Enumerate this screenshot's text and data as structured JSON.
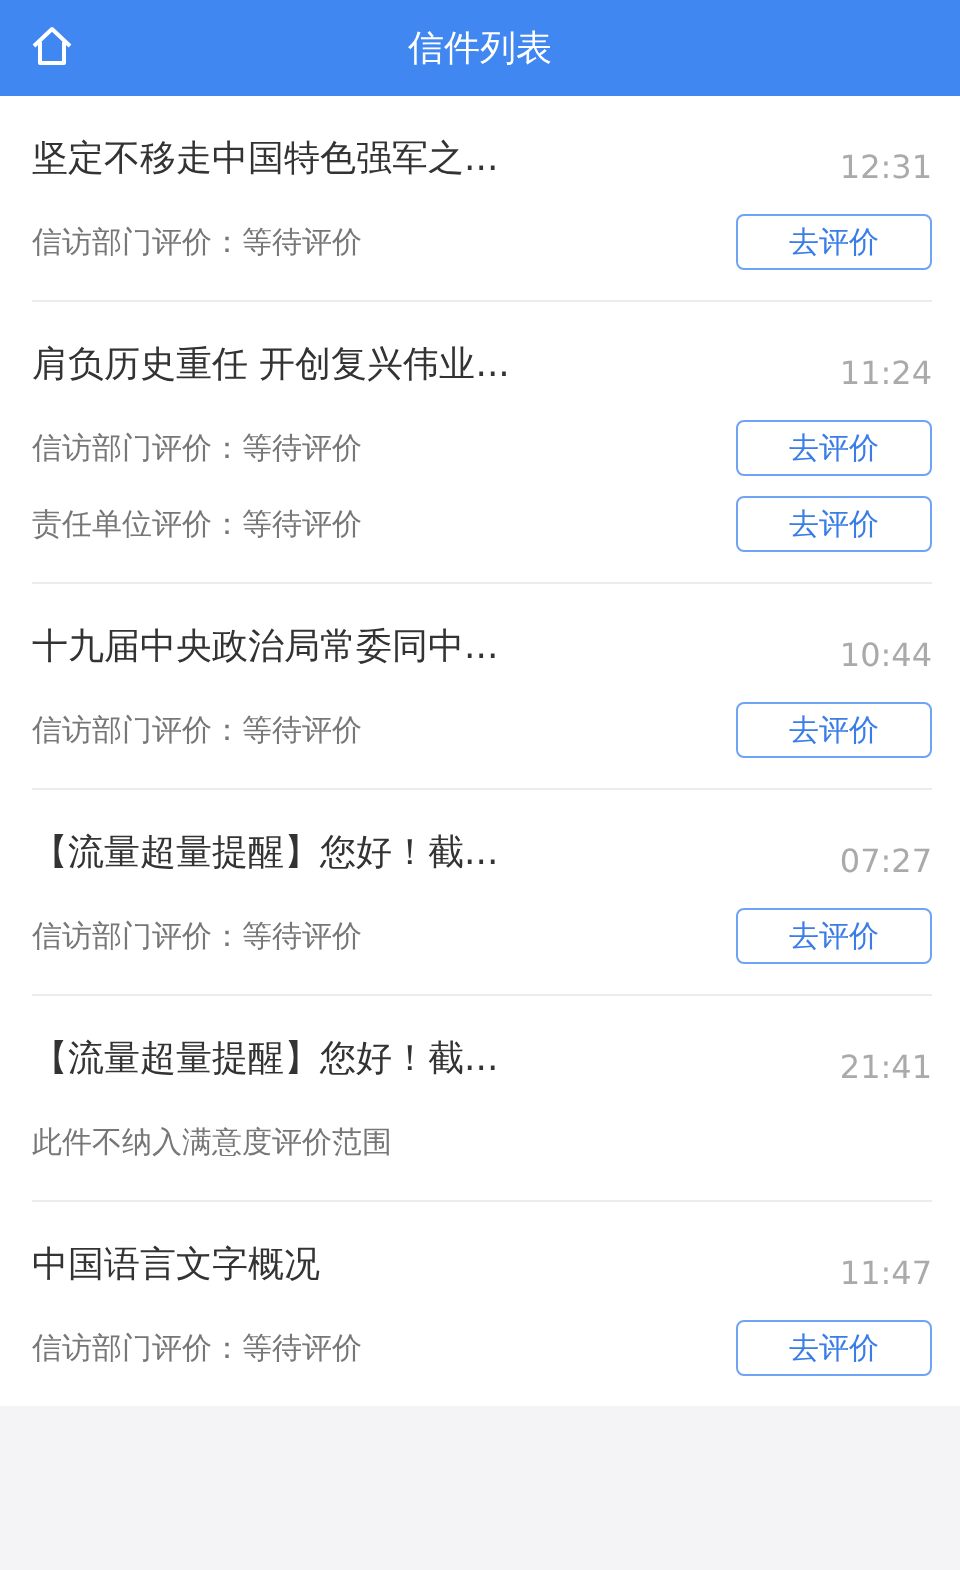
{
  "header": {
    "title": "信件列表"
  },
  "letters": [
    {
      "title": "坚定不移走中国特色强军之...",
      "time": "12:31",
      "rows": [
        {
          "text": "信访部门评价：等待评价",
          "button": "去评价"
        }
      ]
    },
    {
      "title": "肩负历史重任 开创复兴伟业...",
      "time": "11:24",
      "rows": [
        {
          "text": "信访部门评价：等待评价",
          "button": "去评价"
        },
        {
          "text": "责任单位评价：等待评价",
          "button": "去评价"
        }
      ]
    },
    {
      "title": "十九届中央政治局常委同中...",
      "time": "10:44",
      "rows": [
        {
          "text": "信访部门评价：等待评价",
          "button": "去评价"
        }
      ]
    },
    {
      "title": "【流量超量提醒】您好！截...",
      "time": "07:27",
      "rows": [
        {
          "text": "信访部门评价：等待评价",
          "button": "去评价"
        }
      ]
    },
    {
      "title": "【流量超量提醒】您好！截...",
      "time": "21:41",
      "rows": [
        {
          "text": "此件不纳入满意度评价范围"
        }
      ]
    },
    {
      "title": "中国语言文字概况",
      "time": "11:47",
      "rows": [
        {
          "text": "信访部门评价：等待评价",
          "button": "去评价"
        }
      ]
    }
  ]
}
